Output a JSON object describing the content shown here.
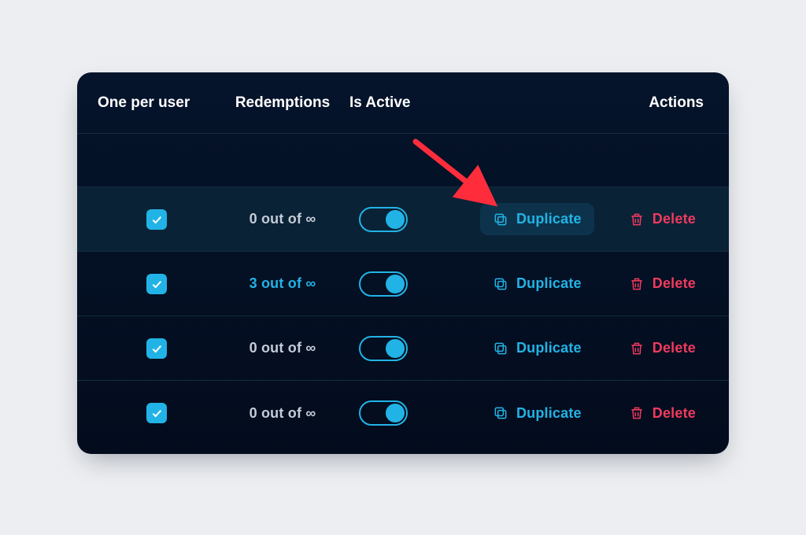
{
  "colors": {
    "accent": "#22b3e6",
    "delete": "#f03a5f",
    "arrow": "#ff2d3c"
  },
  "table": {
    "headers": {
      "one_per_user": "One per user",
      "redemptions": "Redemptions",
      "is_active": "Is Active",
      "actions": "Actions"
    },
    "action_labels": {
      "duplicate": "Duplicate",
      "delete": "Delete"
    },
    "rows": [
      {
        "one_per_user": true,
        "redemptions_text": "0 out of ∞",
        "redemptions_link": false,
        "is_active": true,
        "highlighted": true
      },
      {
        "one_per_user": true,
        "redemptions_text": "3 out of ∞",
        "redemptions_link": true,
        "is_active": true,
        "highlighted": false
      },
      {
        "one_per_user": true,
        "redemptions_text": "0 out of ∞",
        "redemptions_link": false,
        "is_active": true,
        "highlighted": false
      },
      {
        "one_per_user": true,
        "redemptions_text": "0 out of ∞",
        "redemptions_link": false,
        "is_active": true,
        "highlighted": false
      }
    ]
  },
  "annotation": {
    "type": "arrow",
    "targets": "duplicate-button-row-0"
  }
}
